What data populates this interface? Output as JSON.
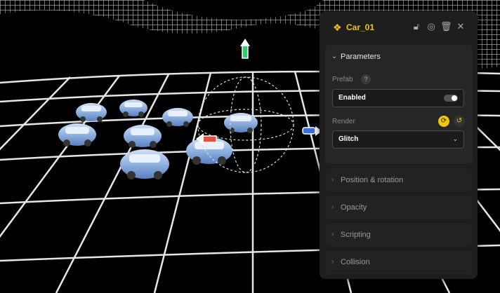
{
  "inspector": {
    "object_name": "Car_01",
    "object_icon": "component-diamond-icon",
    "header_buttons": [
      "lock-icon",
      "target-icon",
      "trash-icon",
      "close-icon"
    ],
    "sections": {
      "parameters": {
        "title": "Parameters",
        "expanded": true,
        "prefab_label": "Prefab",
        "prefab_help": "?",
        "prefab_value": "Enabled",
        "prefab_toggle_on": true,
        "render_label": "Render",
        "render_value": "Glitch"
      },
      "collapsed": [
        {
          "title": "Position & rotation"
        },
        {
          "title": "Opacity"
        },
        {
          "title": "Scripting"
        },
        {
          "title": "Collision"
        }
      ]
    },
    "accent_color": "#f1c40f"
  },
  "scene": {
    "grid_color": "#e6e6e6",
    "gizmo_colors": {
      "y": "#2ecc71",
      "x": "#e74c3c",
      "z": "#3a6fd8"
    }
  }
}
